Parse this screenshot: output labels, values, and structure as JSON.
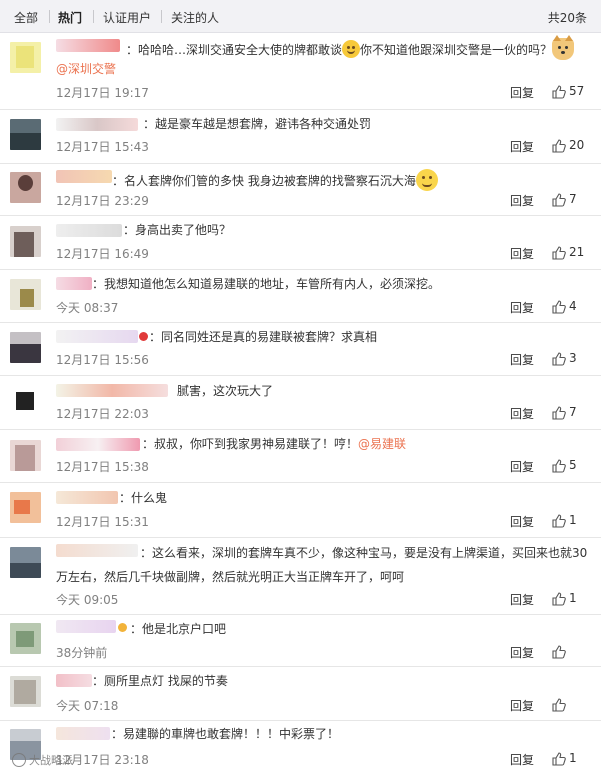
{
  "tabs": [
    {
      "label": "全部"
    },
    {
      "label": "热门"
    },
    {
      "label": "认证用户"
    },
    {
      "label": "关注的人"
    }
  ],
  "total_count": "共20条",
  "reply_label": "回复",
  "comments": [
    {
      "line1": "：哈哈哈…深圳交通安全大使的牌都敢谈",
      "line1b": "你不知道他跟深圳交警是一伙的吗？",
      "mention": "@深圳交警",
      "time": "12月17日 19:17",
      "likes": "57"
    },
    {
      "line1": "：越是豪车越是想套牌，避讳各种交通处罚",
      "time": "12月17日 15:43",
      "likes": "20"
    },
    {
      "line1": "：名人套牌你们管的多快 我身边被套牌的找警察石沉大海",
      "time": "12月17日 23:29",
      "likes": "7"
    },
    {
      "line1": "：身高出卖了他吗？",
      "time": "12月17日 16:49",
      "likes": "21"
    },
    {
      "line1": "：我想知道他怎么知道易建联的地址，车管所有内人，必须深挖。",
      "time": "今天 08:37",
      "likes": "4"
    },
    {
      "line1": "：同名同姓还是真的易建联被套牌？求真相",
      "time": "12月17日 15:56",
      "likes": "3"
    },
    {
      "line1": "腻害，这次玩大了",
      "time": "12月17日 22:03",
      "likes": "7"
    },
    {
      "line1": "：叔叔，你吓到我家男神易建联了！哼！",
      "mention": "@易建联",
      "time": "12月17日 15:38",
      "likes": "5"
    },
    {
      "line1": "：什么鬼",
      "time": "12月17日 15:31",
      "likes": "1"
    },
    {
      "line1": "：这么看来，深圳的套牌车真不少，像这种宝马，要是没有上牌渠道，买回来也就30",
      "line2": "万左右，然后几千块做副牌，然后就光明正大当正牌车开了，呵呵",
      "time": "今天 09:05",
      "likes": "1"
    },
    {
      "line1": "：他是北京户口吧",
      "time": "38分钟前",
      "likes": ""
    },
    {
      "line1": "：厕所里点灯 找屎的节奏",
      "time": "今天 07:18",
      "likes": ""
    },
    {
      "line1": "：易建聯的車牌也敢套牌！！！中彩票了！",
      "time": "12月17日 23:18",
      "likes": "1"
    }
  ],
  "emoji": {
    "laugh": "laugh-emoji",
    "doge": "doge-emoji",
    "smile": "smile-emoji"
  },
  "colors": {
    "mention": "#eb7350",
    "tab_bar": "#f2f2f5",
    "time": "#808080"
  },
  "watermark": "大战略派"
}
